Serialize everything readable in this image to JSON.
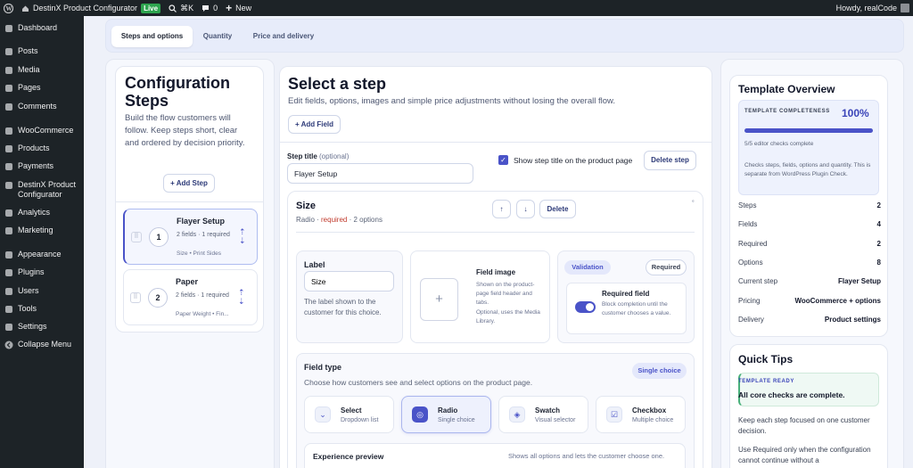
{
  "adminbar": {
    "site": "DestinX Product Configurator",
    "live": "Live",
    "shortcut": "⌘K",
    "comments": "0",
    "new": "New",
    "howdy": "Howdy, realCode"
  },
  "sidebar": {
    "items": [
      "Dashboard",
      "Posts",
      "Media",
      "Pages",
      "Comments",
      "WooCommerce",
      "Products",
      "Payments",
      "DestinX Product Configurator",
      "Analytics",
      "Marketing",
      "Appearance",
      "Plugins",
      "Users",
      "Tools",
      "Settings",
      "Collapse Menu"
    ]
  },
  "tabs": [
    "Steps and options",
    "Quantity",
    "Price and delivery"
  ],
  "left": {
    "title": "Configuration Steps",
    "desc": "Build the flow customers will follow. Keep steps short, clear and ordered by decision priority.",
    "add": "+ Add Step",
    "steps": [
      {
        "num": "1",
        "name": "Flayer Setup",
        "meta": "2 fields · 1 required",
        "sub": "Size • Print Sides"
      },
      {
        "num": "2",
        "name": "Paper",
        "meta": "2 fields · 1 required",
        "sub": "Paper Weight • Fin..."
      }
    ]
  },
  "main": {
    "title": "Select a step",
    "desc": "Edit fields, options, images and simple price adjustments without losing the overall flow.",
    "add_field": "+ Add Field",
    "step_title_label": "Step title",
    "step_title_opt": "(optional)",
    "step_title_value": "Flayer Setup",
    "show_title": "Show step title on the product page",
    "delete_step": "Delete step",
    "field": {
      "name": "Size",
      "type": "Radio",
      "required": "required",
      "options": "2 options",
      "delete": "Delete",
      "up": "↑",
      "down": "↓",
      "dot": "˚"
    },
    "label_box": {
      "title": "Label",
      "value": "Size",
      "help": "The label shown to the customer for this choice."
    },
    "image_box": {
      "title": "Field image",
      "desc": "Shown on the product-page field header and tabs.",
      "opt": "Optional, uses the Media Library.",
      "plus": "+"
    },
    "validation": {
      "tab1": "Validation",
      "tab2": "Required",
      "title": "Required field",
      "desc": "Block completion until the customer chooses a value."
    },
    "field_type": {
      "title": "Field type",
      "desc": "Choose how customers see and select options on the product page.",
      "badge": "Single choice",
      "types": [
        {
          "label": "Select",
          "sub": "Dropdown list",
          "icon": "⌄"
        },
        {
          "label": "Radio",
          "sub": "Single choice",
          "icon": "◎"
        },
        {
          "label": "Swatch",
          "sub": "Visual selector",
          "icon": "◈"
        },
        {
          "label": "Checkbox",
          "sub": "Multiple choice",
          "icon": "☑"
        }
      ]
    },
    "preview": {
      "title": "Experience preview",
      "desc": "Shows all options and lets the customer choose one."
    }
  },
  "overview": {
    "title": "Template Overview",
    "compl_label": "TEMPLATE COMPLETENESS",
    "compl_value": "100%",
    "compl_fraction": 1.0,
    "checks": "5/5 editor checks complete",
    "note": "Checks steps, fields, options and quantity. This is separate from WordPress Plugin Check.",
    "rows": [
      [
        "Steps",
        "2"
      ],
      [
        "Fields",
        "4"
      ],
      [
        "Required",
        "2"
      ],
      [
        "Options",
        "8"
      ],
      [
        "Current step",
        "Flayer Setup"
      ],
      [
        "Pricing",
        "WooCommerce + options"
      ],
      [
        "Delivery",
        "Product settings"
      ]
    ]
  },
  "tips": {
    "title": "Quick Tips",
    "ready_label": "TEMPLATE READY",
    "ready_text": "All core checks are complete.",
    "tip1": "Keep each step focused on one customer decision.",
    "tip2": "Use Required only when the configuration cannot continue without a"
  },
  "colors": {
    "accent": "#4a53c8",
    "admin": "#1d2327"
  }
}
